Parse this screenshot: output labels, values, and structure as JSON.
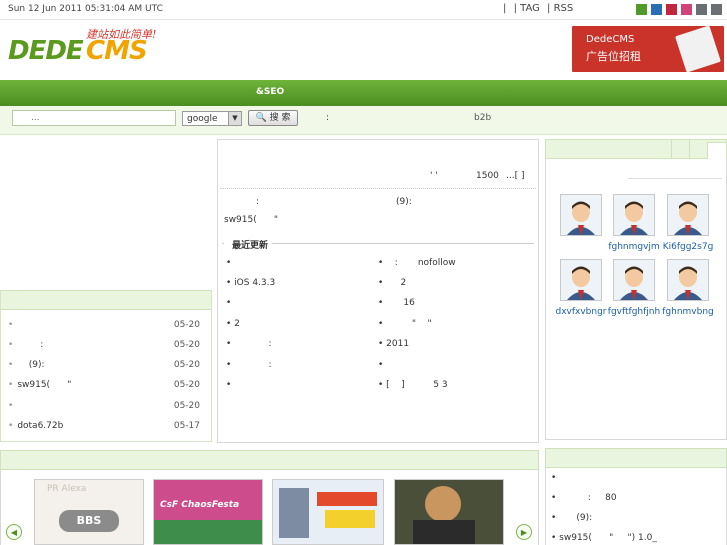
{
  "topbar": {
    "datetime": "Sun 12 Jun 2011 05:31:04 AM UTC",
    "links": [
      "|",
      "| TAG",
      "| RSS"
    ],
    "theme_colors": [
      "#4f9a2b",
      "#2a6fb4",
      "#c2263f",
      "#d0447a",
      "#6b6f74",
      "#6b6f74"
    ]
  },
  "header": {
    "logo_main": "DEDE",
    "logo_accent": "CMS",
    "logo_slogan": "建站如此简单!",
    "ad_line1": "DedeCMS",
    "ad_line2": "广告位招租"
  },
  "nav": {
    "seo_label": "&SEO"
  },
  "search": {
    "input_value": "...",
    "engine_selected": "google",
    "button_label": "搜 索",
    "hot_label": ":",
    "hot_link": "b2b"
  },
  "left_list": [
    {
      "title": "",
      "date": "05-20"
    },
    {
      "title": "        :",
      "date": "05-20"
    },
    {
      "title": "    (9):",
      "date": "05-20"
    },
    {
      "title": "sw915(      \"",
      "date": "05-20"
    },
    {
      "title": "",
      "date": "05-20"
    },
    {
      "title": "dota6.72b",
      "date": "05-17"
    }
  ],
  "middle": {
    "quote_marks": "' '",
    "count": "1500",
    "more": "...[  ]",
    "colon_label": ":",
    "nine_label": "(9):",
    "sw_line": "sw915(      \"",
    "latest_heading": "最近更新",
    "latest_left": [
      "",
      "iOS 4.3.3",
      "",
      "2",
      "            :",
      "            :",
      ""
    ],
    "latest_right": [
      "   :       nofollow",
      "     2",
      "      16",
      "         \"    \"",
      "2011",
      "",
      "[    ]          5 3"
    ]
  },
  "right_users": [
    {
      "name": ""
    },
    {
      "name": "fghnmgvjm"
    },
    {
      "name": "Ki6fgg2s7g"
    },
    {
      "name": "dxvfxvbngr"
    },
    {
      "name": "fgvftfghfjnh"
    },
    {
      "name": "fghnmvbng"
    }
  ],
  "bottom_pics": [
    {
      "caption": "BBS"
    },
    {
      "caption": "CsF ChaosFesta"
    },
    {
      "caption": ""
    },
    {
      "caption": ""
    }
  ],
  "right_bottom": [
    "",
    "          :     80",
    "      (9):",
    "sw915(      \"     \") 1.0_"
  ]
}
